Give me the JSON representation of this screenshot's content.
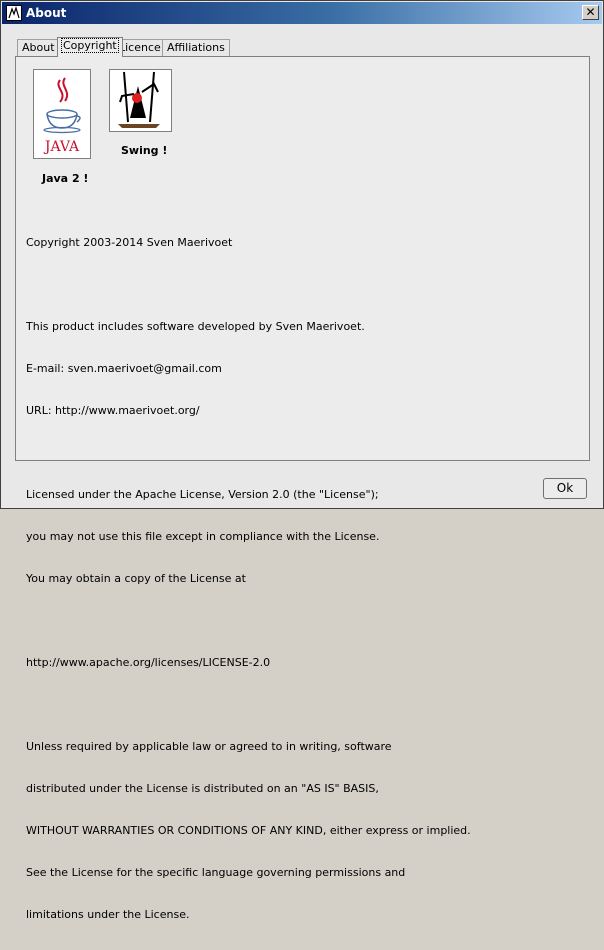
{
  "window": {
    "title": "About"
  },
  "tabs": [
    {
      "label": "About",
      "active": false
    },
    {
      "label": "Copyright",
      "active": true
    },
    {
      "label": "Licence",
      "active": false
    },
    {
      "label": "Affiliations",
      "active": false
    }
  ],
  "logos": {
    "java_caption": "Java 2 !",
    "swing_caption": "Swing !",
    "java_wordmark": "JAVA"
  },
  "content": {
    "lines": [
      "Copyright 2003-2014 Sven Maerivoet",
      "",
      "This product includes software developed by Sven Maerivoet.",
      "E-mail: sven.maerivoet@gmail.com",
      "URL: http://www.maerivoet.org/",
      "",
      "Licensed under the Apache License, Version 2.0 (the \"License\");",
      "you may not use this file except in compliance with the License.",
      "You may obtain a copy of the License at",
      "",
      "http://www.apache.org/licenses/LICENSE-2.0",
      "",
      "Unless required by applicable law or agreed to in writing, software",
      "distributed under the License is distributed on an \"AS IS\" BASIS,",
      "WITHOUT WARRANTIES OR CONDITIONS OF ANY KIND, either express or implied.",
      "See the License for the specific language governing permissions and",
      "limitations under the License."
    ]
  },
  "buttons": {
    "ok_label": "Ok"
  },
  "icons": {
    "app": "app-icon",
    "close": "close-icon",
    "java_logo": "java-cup-icon",
    "swing_logo": "duke-swing-icon"
  },
  "colors": {
    "titlebar_start": "#0a246a",
    "titlebar_end": "#a6caf0",
    "java_red": "#c8102e"
  }
}
